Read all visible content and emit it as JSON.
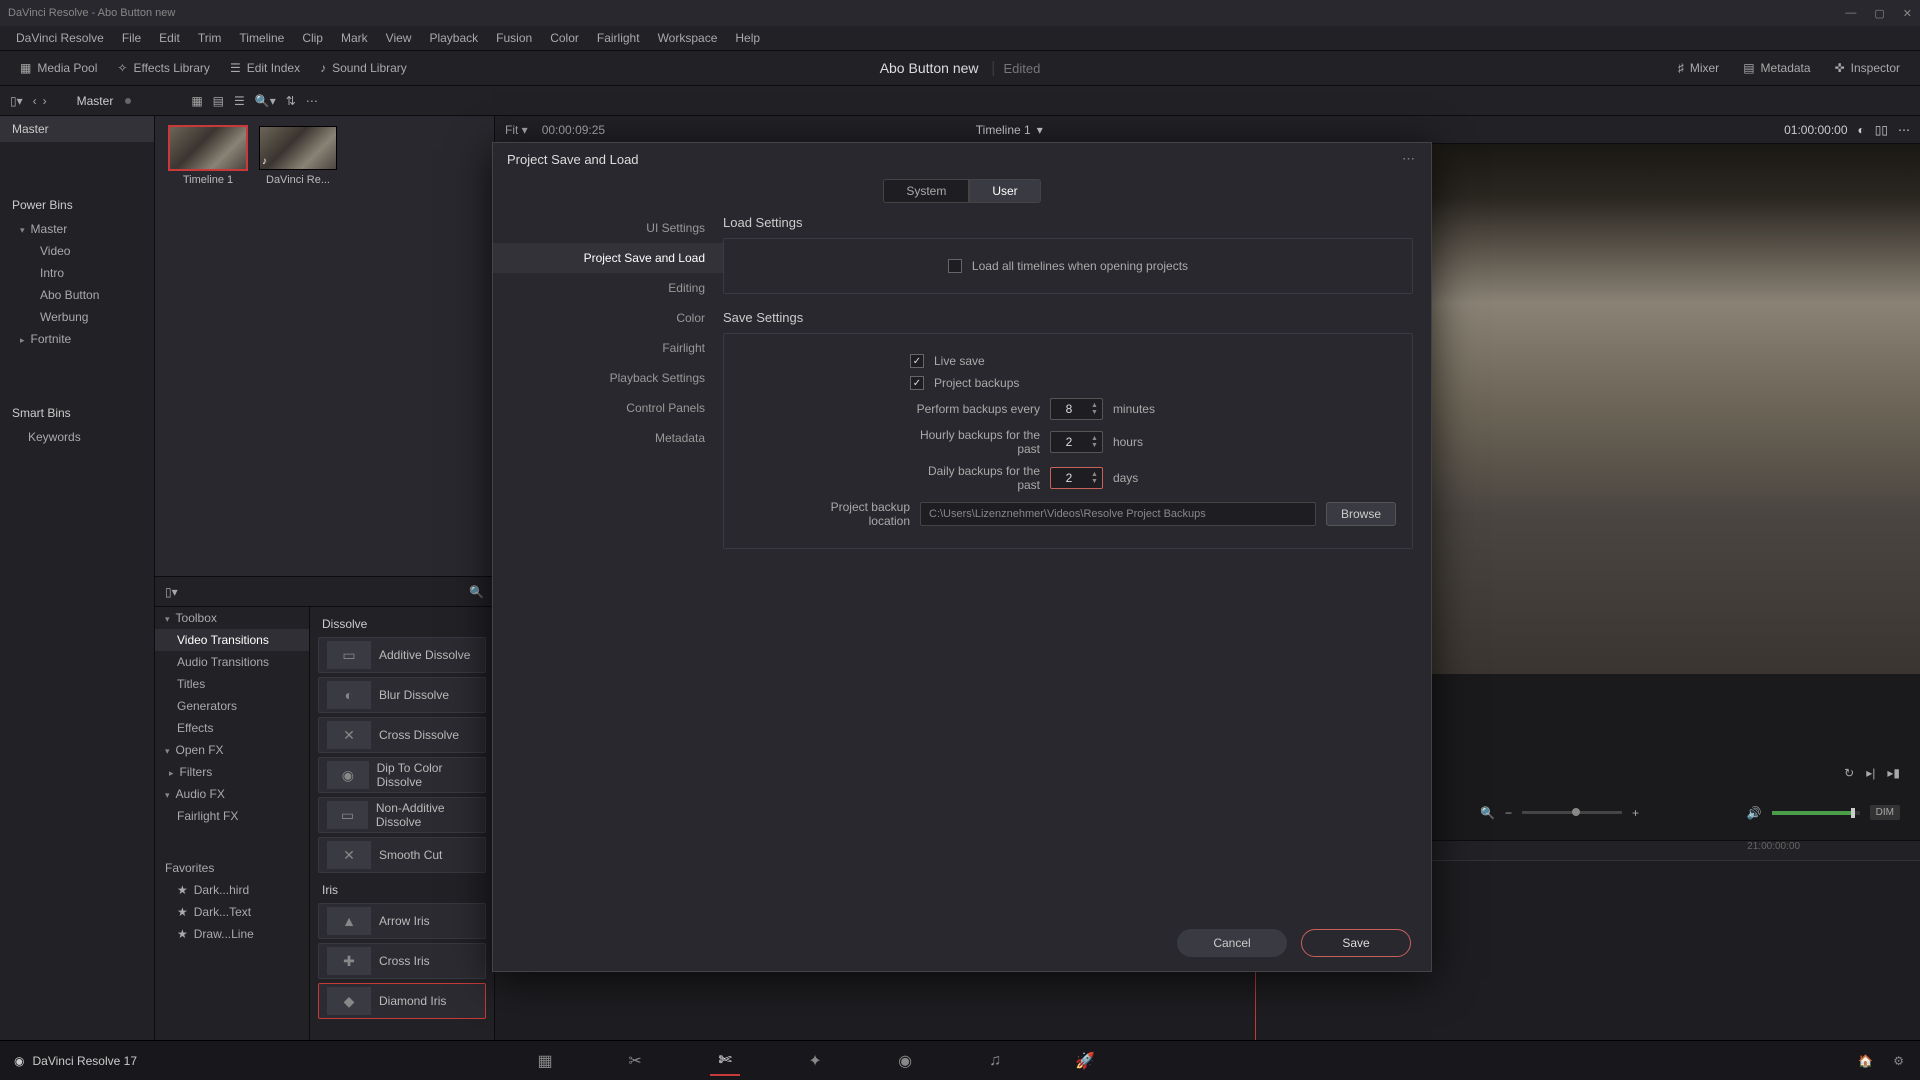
{
  "titlebar": {
    "text": "DaVinci Resolve - Abo Button new"
  },
  "menus": [
    "DaVinci Resolve",
    "File",
    "Edit",
    "Trim",
    "Timeline",
    "Clip",
    "Mark",
    "View",
    "Playback",
    "Fusion",
    "Color",
    "Fairlight",
    "Workspace",
    "Help"
  ],
  "tool_buttons": {
    "media_pool": "Media Pool",
    "effects_library": "Effects Library",
    "edit_index": "Edit Index",
    "sound_library": "Sound Library",
    "mixer": "Mixer",
    "metadata": "Metadata",
    "inspector": "Inspector"
  },
  "project": {
    "name": "Abo Button new",
    "status": "Edited"
  },
  "secbar": {
    "breadcrumb": "Master",
    "fit": "Fit",
    "timecode_left": "00:00:09:25",
    "timeline_name": "Timeline 1",
    "timecode_right": "01:00:00:00"
  },
  "bins": {
    "master": "Master",
    "power_bins": "Power Bins",
    "pb_master": "Master",
    "items": [
      "Video",
      "Intro",
      "Abo Button",
      "Werbung",
      "Fortnite"
    ],
    "smart_bins": "Smart Bins",
    "keywords": "Keywords"
  },
  "thumbs": [
    {
      "label": "Timeline 1"
    },
    {
      "label": "DaVinci Re..."
    }
  ],
  "fx": {
    "tree": [
      {
        "label": "Toolbox",
        "hdr": true
      },
      {
        "label": "Video Transitions",
        "active": true
      },
      {
        "label": "Audio Transitions"
      },
      {
        "label": "Titles"
      },
      {
        "label": "Generators"
      },
      {
        "label": "Effects"
      },
      {
        "label": "Open FX",
        "hdr": true
      },
      {
        "label": "Filters"
      },
      {
        "label": "Audio FX",
        "hdr": true
      },
      {
        "label": "Fairlight FX"
      }
    ],
    "favorites_hdr": "Favorites",
    "favorites": [
      "Dark...hird",
      "Dark...Text",
      "Draw...Line"
    ],
    "group1": "Dissolve",
    "dissolves": [
      "Additive Dissolve",
      "Blur Dissolve",
      "Cross Dissolve",
      "Dip To Color Dissolve",
      "Non-Additive Dissolve",
      "Smooth Cut"
    ],
    "group2": "Iris",
    "iris": [
      "Arrow Iris",
      "Cross Iris",
      "Diamond Iris"
    ]
  },
  "dialog": {
    "title": "Project Save and Load",
    "tabs": {
      "system": "System",
      "user": "User"
    },
    "nav": [
      "UI Settings",
      "Project Save and Load",
      "Editing",
      "Color",
      "Fairlight",
      "Playback Settings",
      "Control Panels",
      "Metadata"
    ],
    "nav_active": 1,
    "load_hdr": "Load Settings",
    "load_all": "Load all timelines when opening projects",
    "save_hdr": "Save Settings",
    "live_save": "Live save",
    "project_backups": "Project backups",
    "perform_every": "Perform backups every",
    "minutes": "minutes",
    "perform_value": "8",
    "hourly": "Hourly backups for the past",
    "hours": "hours",
    "hourly_value": "2",
    "daily": "Daily backups for the past",
    "days": "days",
    "daily_value": "2",
    "location_lbl": "Project backup location",
    "location_val": "C:\\Users\\Lizenznehmer\\Videos\\Resolve Project Backups",
    "browse": "Browse",
    "cancel": "Cancel",
    "save": "Save"
  },
  "viewer": {
    "dim_label": "DIM",
    "timeline_tc": "21:00:00:00"
  },
  "pagebar": {
    "app": "DaVinci Resolve 17"
  }
}
